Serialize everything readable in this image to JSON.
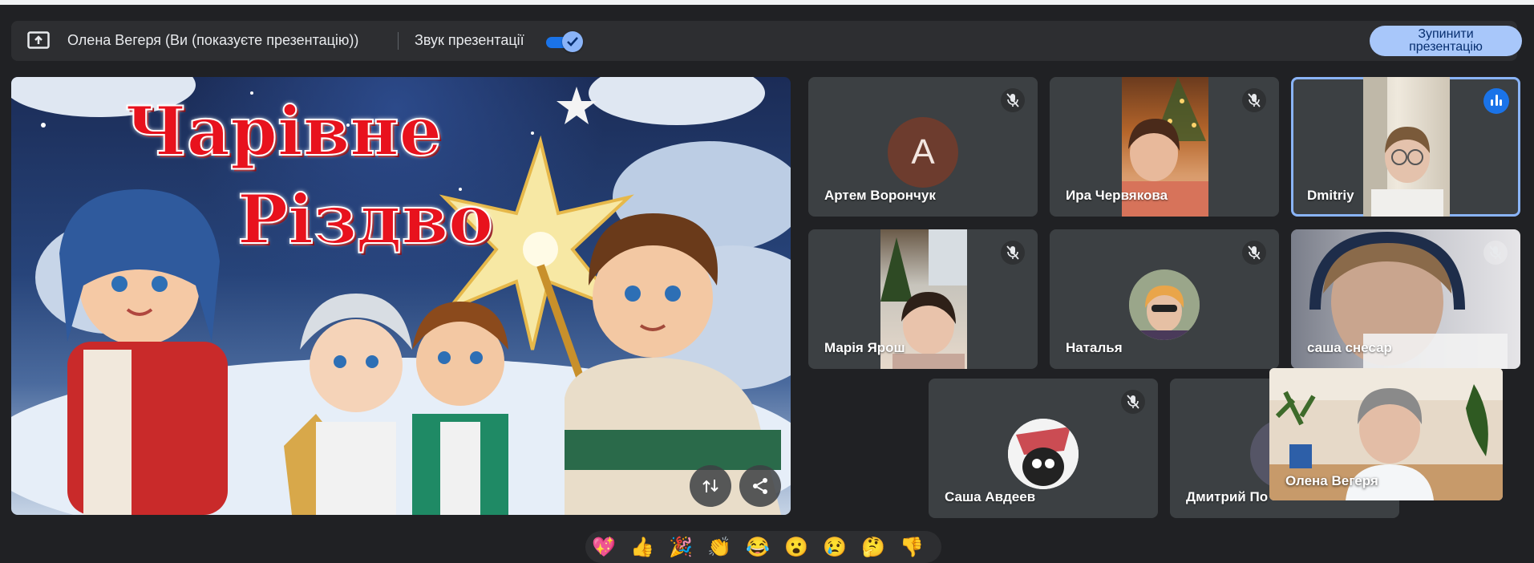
{
  "presenting_bar": {
    "presenter": "Олена Вегеря (Ви (показуєте презентацію))",
    "audio_label": "Звук презентації",
    "audio_on": true,
    "stop_button": "Зупинити презентацію"
  },
  "slide": {
    "title_line1": "Чарівне",
    "title_line2": "Різдво"
  },
  "participants": [
    {
      "name": "Артем Ворончук",
      "initial": "А",
      "muted": true
    },
    {
      "name": "Ира Червякова",
      "muted": true
    },
    {
      "name": "Dmitriy",
      "speaking": true
    },
    {
      "name": "Марія Ярош",
      "muted": true
    },
    {
      "name": "Наталья",
      "muted": true
    },
    {
      "name": "саша снесар",
      "muted": true
    },
    {
      "name": "Саша Авдеев",
      "muted": true
    },
    {
      "name": "Дмитрий По"
    }
  ],
  "self_view": {
    "name": "Олена Вегеря"
  },
  "colors": {
    "background": "#202124",
    "tile": "#3c4043",
    "accent": "#8ab4f8",
    "stop_button_bg": "#a8c7fa"
  },
  "reactions": [
    "💖",
    "👍",
    "🎉",
    "👏",
    "😂",
    "😮",
    "😢",
    "🤔",
    "👎"
  ]
}
